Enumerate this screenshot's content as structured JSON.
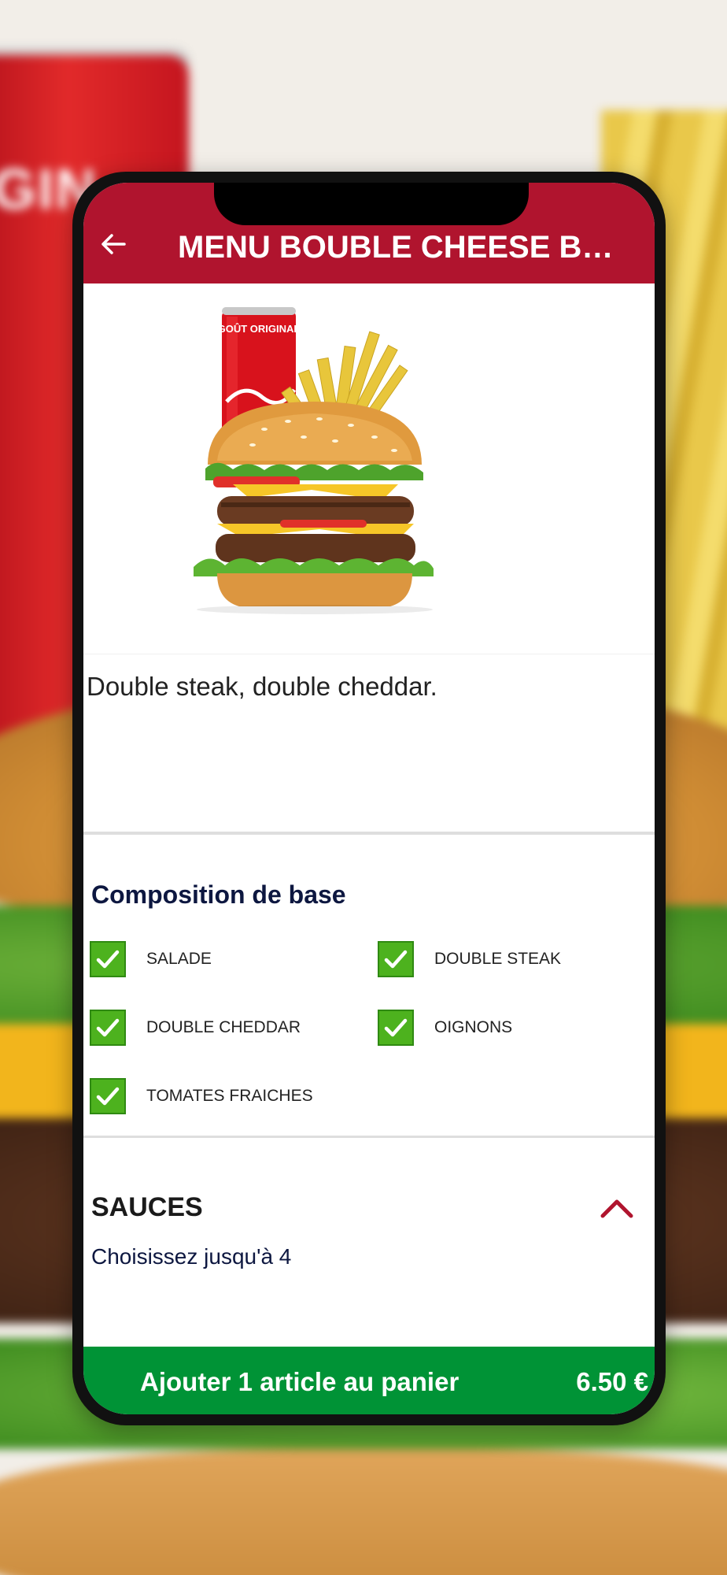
{
  "header": {
    "title": "MENU BOUBLE CHEESE BURGER"
  },
  "product": {
    "can_text": "GOÛT ORIGINAL",
    "description": "Double steak, double cheddar."
  },
  "composition": {
    "title": "Composition de base",
    "items": [
      {
        "label": "SALADE",
        "checked": true
      },
      {
        "label": "DOUBLE STEAK",
        "checked": true
      },
      {
        "label": "DOUBLE CHEDDAR",
        "checked": true
      },
      {
        "label": "OIGNONS",
        "checked": true
      },
      {
        "label": "TOMATES FRAICHES",
        "checked": true
      }
    ]
  },
  "sauces": {
    "title": "SAUCES",
    "subtitle": "Choisissez jusqu'à 4"
  },
  "cart": {
    "label": "Ajouter 1 article au panier",
    "price": "6.50 €"
  },
  "colors": {
    "header": "#b0142e",
    "check": "#4db21e",
    "cart": "#009336",
    "accent_text": "#0d1740"
  },
  "background": {
    "can_text": "GIN"
  }
}
